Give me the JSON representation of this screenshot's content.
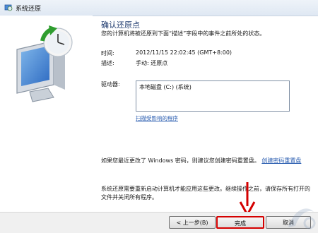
{
  "window": {
    "title": "系统还原"
  },
  "main": {
    "heading": "确认还原点",
    "description": "您的计算机将被还原到下面“描述”字段中的事件之前所处的状态。",
    "time_label": "时间:",
    "time_value": "2012/11/15 22:02:45 (GMT+8:00)",
    "desc_label": "描述:",
    "desc_value": "手动: 还原点",
    "drives_label": "驱动器:",
    "drives": [
      "本地磁盘 (C:) (系统)"
    ],
    "scan_link": "扫描受影响的程序",
    "note1_text": "如果您最近更改了 Windows 密码，则建议您创建密码重置盘。",
    "note1_link": "创建密码重置盘",
    "note2": "系统还原需要重新启动计算机才能应用这些更改。继续操作之前，请保存所有打开的文件并关闭所有程序。"
  },
  "buttons": {
    "back": "< 上一步(B)",
    "finish": "完成",
    "cancel": "取消"
  },
  "colors": {
    "highlight": "#d40000",
    "link": "#2a5db0"
  }
}
